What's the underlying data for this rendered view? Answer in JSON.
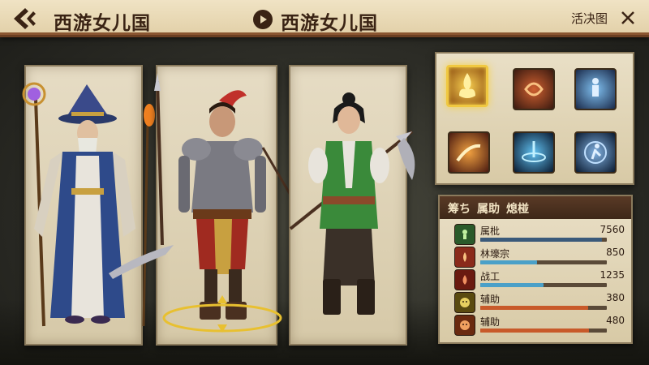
{
  "header": {
    "title_left": "西游女儿国",
    "title_center": "西游女儿国",
    "link": "活决图"
  },
  "characters": [
    {
      "name": "wizard",
      "role": "mage"
    },
    {
      "name": "warrior",
      "role": "warrior"
    },
    {
      "name": "ranger",
      "role": "spearwoman"
    }
  ],
  "skills": [
    {
      "icon": "golden-flame-icon",
      "selected": true
    },
    {
      "icon": "fire-swirl-icon",
      "selected": false
    },
    {
      "icon": "blue-figure-icon",
      "selected": false
    },
    {
      "icon": "fire-slash-icon",
      "selected": false
    },
    {
      "icon": "water-burst-icon",
      "selected": false
    },
    {
      "icon": "blue-runner-icon",
      "selected": false
    }
  ],
  "stats": {
    "header": [
      "筹ち",
      "属助",
      "熄椪"
    ],
    "rows": [
      {
        "label": "属枇",
        "value": "7560",
        "fill": 0.96,
        "color": "#3a5a7a",
        "icon": "green-figure-icon"
      },
      {
        "label": "林壕宗",
        "value": "850",
        "fill": 0.45,
        "color": "#4aa0c8",
        "icon": "red-flame-icon"
      },
      {
        "label": "战工",
        "value": "1235",
        "fill": 0.5,
        "color": "#4aa0c8",
        "icon": "dark-flame-icon"
      },
      {
        "label": "辅助",
        "value": "380",
        "fill": 0.85,
        "color": "#c85a2a",
        "icon": "golden-mask-icon"
      },
      {
        "label": "辅助",
        "value": "480",
        "fill": 0.86,
        "color": "#c85a2a",
        "icon": "red-mask-icon"
      }
    ]
  },
  "colors": {
    "topbar": "#e8d8b4",
    "border_dark": "#6b3f22",
    "card": "#ddd1b4",
    "selected_glow": "#f0c840"
  }
}
